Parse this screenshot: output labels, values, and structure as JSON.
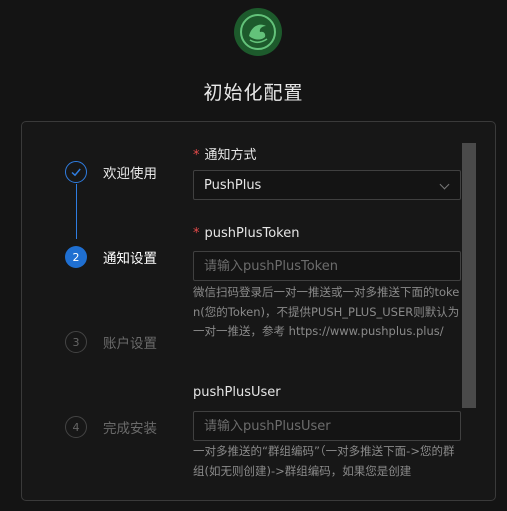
{
  "app": {
    "logo_icon": "dragon-logo-icon",
    "title": "初始化配置"
  },
  "colors": {
    "accent": "#1f6fd1",
    "required": "#e84b4b",
    "background": "#141414"
  },
  "steps": [
    {
      "label": "欢迎使用",
      "status": "done",
      "icon": "check-icon"
    },
    {
      "number": "2",
      "label": "通知设置",
      "status": "active"
    },
    {
      "number": "3",
      "label": "账户设置",
      "status": "wait"
    },
    {
      "number": "4",
      "label": "完成安装",
      "status": "wait"
    }
  ],
  "form": {
    "notify_method": {
      "required_mark": "*",
      "label": "通知方式",
      "value": "PushPlus"
    },
    "push_plus_token": {
      "required_mark": "*",
      "label": "pushPlusToken",
      "placeholder": "请输入pushPlusToken",
      "value": "",
      "help": "微信扫码登录后一对一推送或一对多推送下面的token(您的Token)，不提供PUSH_PLUS_USER则默认为一对一推送，参考 https://www.pushplus.plus/"
    },
    "push_plus_user": {
      "label": "pushPlusUser",
      "placeholder": "请输入pushPlusUser",
      "value": "",
      "help": "一对多推送的“群组编码”（一对多推送下面->您的群组(如无则创建)->群组编码，如果您是创建"
    }
  }
}
